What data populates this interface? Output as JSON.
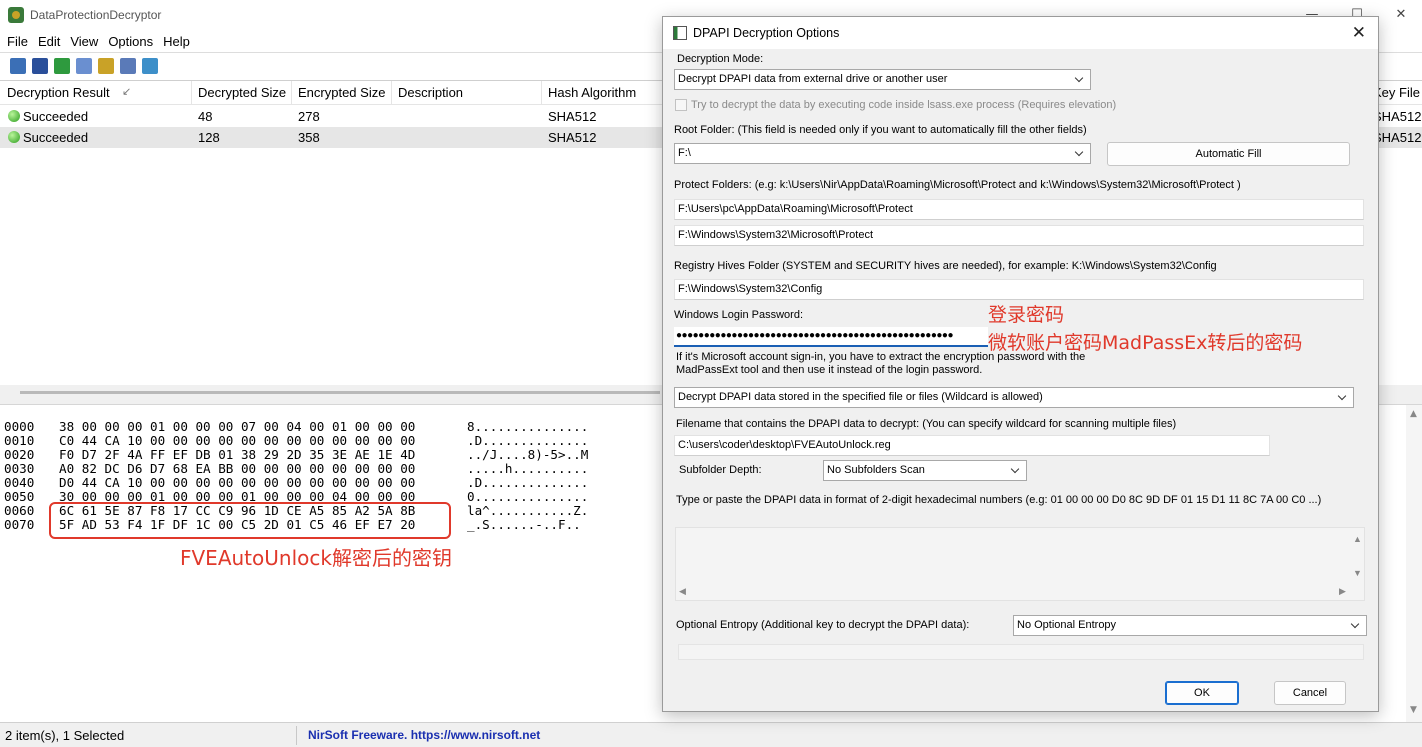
{
  "app": {
    "title": "DataProtectionDecryptor",
    "menu": [
      "File",
      "Edit",
      "View",
      "Options",
      "Help"
    ]
  },
  "list": {
    "columns": [
      "Decryption Result",
      "Decrypted Size",
      "Encrypted Size",
      "Description",
      "Hash Algorithm",
      "Key File"
    ],
    "sort_indicator": "↙",
    "rows": [
      {
        "result": "Succeeded",
        "decrypted_size": "48",
        "encrypted_size": "278",
        "description": "",
        "hash": "SHA512",
        "key_file": "SHA512"
      },
      {
        "result": "Succeeded",
        "decrypted_size": "128",
        "encrypted_size": "358",
        "description": "",
        "hash": "SHA512",
        "key_file": "SHA512"
      }
    ]
  },
  "hex": {
    "lines": [
      {
        "offset": "0000",
        "bytes": "38 00 00 00 01 00 00 00 07 00 04 00 01 00 00 00",
        "ascii": "8..............."
      },
      {
        "offset": "0010",
        "bytes": "C0 44 CA 10 00 00 00 00 00 00 00 00 00 00 00 00",
        "ascii": ".D.............."
      },
      {
        "offset": "0020",
        "bytes": "F0 D7 2F 4A FF EF DB 01 38 29 2D 35 3E AE 1E 4D",
        "ascii": "../J....8)-5>..M"
      },
      {
        "offset": "0030",
        "bytes": "A0 82 DC D6 D7 68 EA BB 00 00 00 00 00 00 00 00",
        "ascii": ".....h.........."
      },
      {
        "offset": "0040",
        "bytes": "D0 44 CA 10 00 00 00 00 00 00 00 00 00 00 00 00",
        "ascii": ".D.............."
      },
      {
        "offset": "0050",
        "bytes": "30 00 00 00 01 00 00 00 01 00 00 00 04 00 00 00",
        "ascii": "0..............."
      },
      {
        "offset": "0060",
        "bytes": "6C 61 5E 87 F8 17 CC C9 96 1D CE A5 85 A2 5A 8B",
        "ascii": "la^...........Z."
      },
      {
        "offset": "0070",
        "bytes": "5F AD 53 F4 1F DF 1C 00 C5 2D 01 C5 46 EF E7 20",
        "ascii": "_.S......-..F.."
      }
    ],
    "annotation": "FVEAutoUnlock解密后的密钥"
  },
  "status": {
    "items": "2 item(s), 1 Selected",
    "credit": "NirSoft Freeware. https://www.nirsoft.net"
  },
  "dialog": {
    "title": "DPAPI Decryption Options",
    "decryption_mode_label": "Decryption Mode:",
    "decryption_mode_value": "Decrypt DPAPI data from external drive or another user",
    "lsass_checkbox_label": "Try to decrypt the data by executing code inside lsass.exe process (Requires elevation)",
    "root_folder_label": "Root Folder: (This field is needed only if you want to automatically fill the other fields)",
    "root_folder_value": "F:\\",
    "automatic_fill_label": "Automatic Fill",
    "protect_folders_label": "Protect Folders: (e.g: k:\\Users\\Nir\\AppData\\Roaming\\Microsoft\\Protect and k:\\Windows\\System32\\Microsoft\\Protect )",
    "protect_folder_1": "F:\\Users\\pc\\AppData\\Roaming\\Microsoft\\Protect",
    "protect_folder_2": "F:\\Windows\\System32\\Microsoft\\Protect",
    "registry_label": "Registry Hives Folder (SYSTEM and SECURITY hives are needed), for example:  K:\\Windows\\System32\\Config",
    "registry_value": "F:\\Windows\\System32\\Config",
    "password_label": "Windows Login Password:",
    "password_value": "●●●●●●●●●●●●●●●●●●●●●●●●●●●●●●●●●●●●●●●●●●●●●●●●●●",
    "ms_account_note_1": "If it's Microsoft account sign-in, you have to extract the encryption password with the",
    "ms_account_note_2": "MadPassExt tool and then use it instead of the login password.",
    "data_source_value": "Decrypt DPAPI data stored in the specified file or files (Wildcard is allowed)",
    "filename_label": "Filename that contains the DPAPI data to decrypt: (You can specify wildcard for scanning multiple files)",
    "filename_value": "C:\\users\\coder\\desktop\\FVEAutoUnlock.reg",
    "subfolder_label": "Subfolder Depth:",
    "subfolder_value": "No Subfolders Scan",
    "hex_data_label": "Type or paste the DPAPI data in format of 2-digit hexadecimal numbers (e.g: 01 00 00 00 D0 8C 9D DF 01 15 D1 11 8C 7A 00 C0 ...)",
    "entropy_label": "Optional Entropy (Additional key to decrypt the DPAPI data):",
    "entropy_value": "No Optional Entropy",
    "ok_label": "OK",
    "cancel_label": "Cancel",
    "annotation_1": "登录密码",
    "annotation_2": "微软账户密码MadPassEx转后的密码"
  },
  "colors": {
    "annotation": "#e0392b",
    "link": "#1a2fb0",
    "focus": "#1a5fb4"
  }
}
